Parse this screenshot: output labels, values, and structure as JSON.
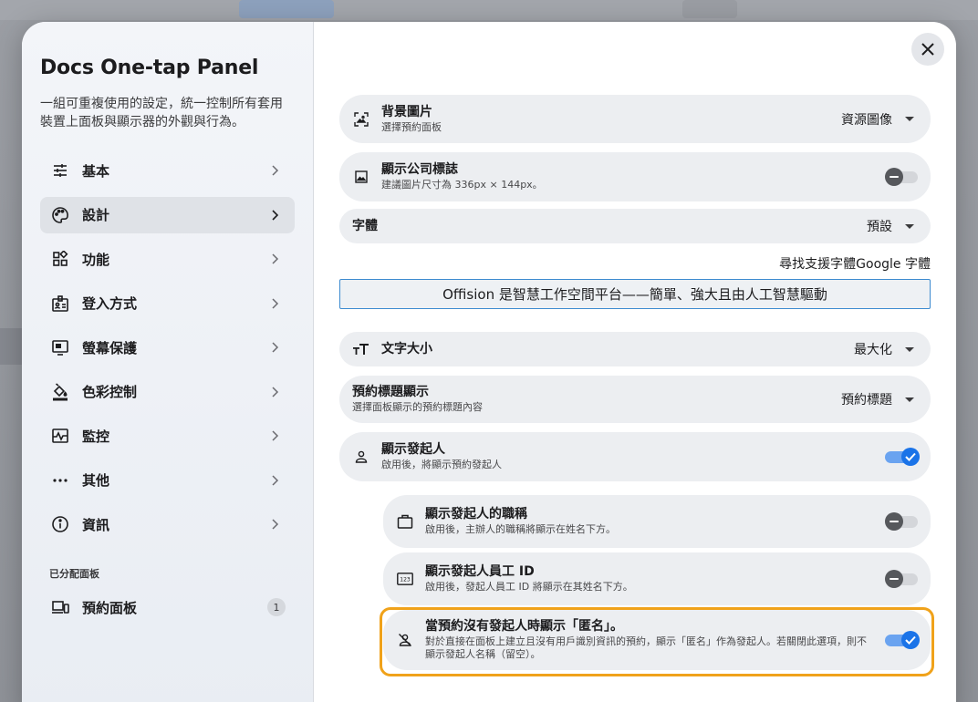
{
  "sidebar": {
    "title": "Docs One-tap Panel",
    "description": "一組可重複使用的設定，統一控制所有套用裝置上面板與顯示器的外觀與行為。",
    "items": [
      {
        "label": "基本",
        "icon": "sliders-icon"
      },
      {
        "label": "設計",
        "icon": "palette-icon"
      },
      {
        "label": "功能",
        "icon": "apps-icon"
      },
      {
        "label": "登入方式",
        "icon": "badge-login-icon"
      },
      {
        "label": "螢幕保護",
        "icon": "screensaver-icon"
      },
      {
        "label": "色彩控制",
        "icon": "paint-bucket-icon"
      },
      {
        "label": "監控",
        "icon": "monitoring-icon"
      },
      {
        "label": "其他",
        "icon": "more-icon"
      },
      {
        "label": "資訊",
        "icon": "info-icon"
      }
    ],
    "active_index": 1,
    "section_label": "已分配面板",
    "panel_item": {
      "label": "預約面板",
      "count": "1",
      "icon": "devices-icon"
    }
  },
  "settings": {
    "background_image": {
      "title": "背景圖片",
      "subtitle": "選擇預約面板",
      "value": "資源圖像"
    },
    "company_logo": {
      "title": "顯示公司標誌",
      "subtitle": "建議圖片尺寸為 336px × 144px。",
      "enabled": false
    },
    "font": {
      "title": "字體",
      "value": "預設"
    },
    "font_links": "尋找支援字體Google 字體",
    "preview_text": "Offision 是智慧工作空間平台——簡單、強大且由人工智慧驅動",
    "text_size": {
      "title": "文字大小",
      "value": "最大化"
    },
    "booking_title": {
      "title": "預約標題顯示",
      "subtitle": "選擇面板顯示的預約標題內容",
      "value": "預約標題"
    },
    "show_organizer": {
      "title": "顯示發起人",
      "subtitle": "啟用後，將顯示預約發起人",
      "enabled": true
    },
    "organizer_job_title": {
      "title": "顯示發起人的職稱",
      "subtitle": "啟用後，主辦人的職稱將顯示在姓名下方。",
      "enabled": false
    },
    "organizer_employee_id": {
      "title": "顯示發起人員工 ID",
      "subtitle": "啟用後，發起人員工 ID 將顯示在其姓名下方。",
      "enabled": false
    },
    "anonymous": {
      "title": "當預約沒有發起人時顯示「匿名」。",
      "subtitle": "對於直接在面板上建立且沒有用戶識別資訊的預約，顯示「匿名」作為發起人。若關閉此選項，則不顯示發起人名稱（留空）。",
      "enabled": true
    }
  },
  "colors": {
    "accent": "#1a73e8",
    "highlight": "#f0a21a"
  }
}
